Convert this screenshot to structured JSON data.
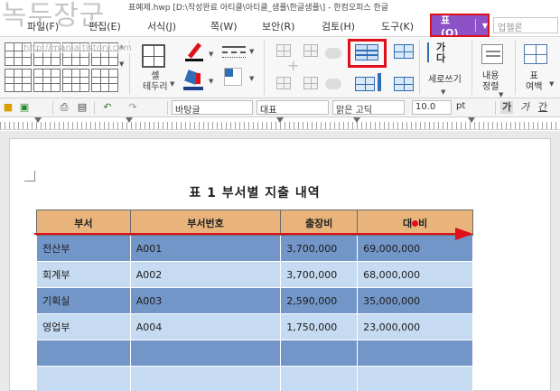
{
  "window": {
    "title": "표예제.hwp [D:\\작성완료 아티클\\아티클_샘플\\한글샘플\\] - 한컴오피스 한글"
  },
  "watermark": {
    "main": "녹두장군",
    "url": "http://mania.tistory.com"
  },
  "menu": {
    "items": [
      "파일(F)",
      "편집(E)",
      "서식(J)",
      "쪽(W)",
      "보안(R)",
      "검토(H)",
      "도구(K)"
    ],
    "active": "표(Q)",
    "search_placeholder": "업첼론"
  },
  "ribbon": {
    "cell_border_label": "셀\n테두리",
    "vertical_text_label": "세로쓰기",
    "content_align_label": "내용\n정렬",
    "table_margin_label": "표\n여백",
    "ga_label": "가\n다"
  },
  "format_bar": {
    "style": "바탕글",
    "lang": "대표",
    "font": "맑은 고딕",
    "size": "10.0",
    "unit": "pt",
    "bold": "가",
    "italic": "가",
    "underline": "간"
  },
  "document": {
    "table_title": "표 1 부서별 지출 내역",
    "headers": [
      "부서",
      "부서번호",
      "출장비",
      "대●비"
    ],
    "rows": [
      {
        "dept": "전산부",
        "code": "A001",
        "travel": "3,700,000",
        "other": "69,000,000"
      },
      {
        "dept": "회계부",
        "code": "A002",
        "travel": "3,700,000",
        "other": "68,000,000"
      },
      {
        "dept": "기획실",
        "code": "A003",
        "travel": "2,590,000",
        "other": "35,000,000"
      },
      {
        "dept": "영업부",
        "code": "A004",
        "travel": "1,750,000",
        "other": "23,000,000"
      },
      {
        "dept": "",
        "code": "",
        "travel": "",
        "other": ""
      },
      {
        "dept": "",
        "code": "",
        "travel": "",
        "other": ""
      }
    ]
  },
  "colors": {
    "header_fill": "#e8b47c",
    "dark_row": "#7396c8",
    "light_row": "#c6dbf2",
    "annotation_red": "#e0101b",
    "active_menu": "#8d53c6"
  }
}
